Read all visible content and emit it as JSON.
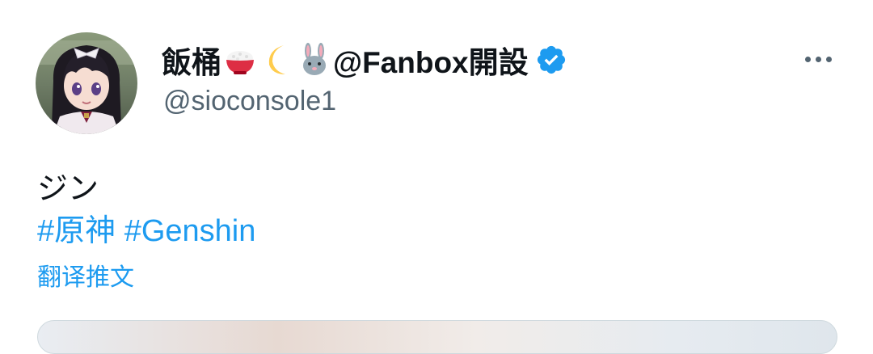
{
  "author": {
    "display_name_prefix": "飯桶",
    "display_name_suffix": "@Fanbox開設",
    "name_emojis": [
      "rice-bowl-emoji",
      "crescent-moon-emoji",
      "rabbit-emoji"
    ],
    "handle": "@sioconsole1",
    "verified": true,
    "verified_color": "#1d9bf0"
  },
  "tweet": {
    "text": "ジン",
    "hashtags": [
      "#原神",
      "#Genshin"
    ],
    "translate_label": "翻译推文"
  },
  "colors": {
    "text": "#0f1419",
    "secondary": "#536471",
    "link": "#1d9bf0"
  },
  "icons": {
    "more": "more-horizontal-icon",
    "verified": "verified-badge-icon"
  }
}
